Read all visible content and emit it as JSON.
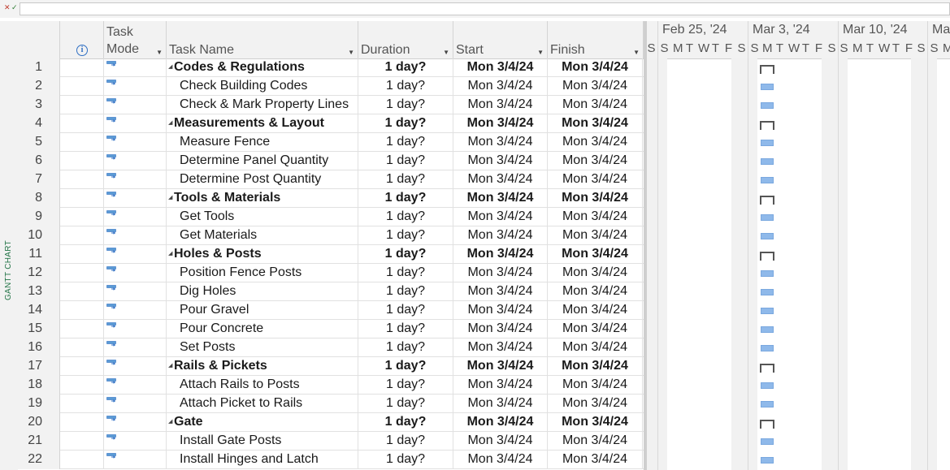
{
  "app": {
    "view_label": "GANTT CHART"
  },
  "entry_bar": {
    "cancel_icon": "cancel-x-icon",
    "accept_icon": "accept-check-icon",
    "value": ""
  },
  "columns": {
    "info_icon": "info-icon",
    "task_mode": "Task\nMode",
    "task_name": "Task Name",
    "duration": "Duration",
    "start": "Start",
    "finish": "Finish"
  },
  "timescale": {
    "weeks": [
      "Feb 25, '24",
      "Mar 3, '24",
      "Mar 10, '24",
      "Ma"
    ],
    "days": [
      "S",
      "S",
      "M",
      "T",
      "W",
      "T",
      "F",
      "S",
      "S",
      "M",
      "T",
      "W",
      "T",
      "F",
      "S",
      "S",
      "M",
      "T",
      "W",
      "T",
      "F",
      "S",
      "S",
      "M"
    ]
  },
  "tasks": [
    {
      "id": "1",
      "name": "Codes & Regulations",
      "duration": "1 day?",
      "start": "Mon 3/4/24",
      "finish": "Mon 3/4/24",
      "summary": true
    },
    {
      "id": "2",
      "name": "Check Building Codes",
      "duration": "1 day?",
      "start": "Mon 3/4/24",
      "finish": "Mon 3/4/24",
      "summary": false
    },
    {
      "id": "3",
      "name": "Check & Mark Property Lines",
      "duration": "1 day?",
      "start": "Mon 3/4/24",
      "finish": "Mon 3/4/24",
      "summary": false
    },
    {
      "id": "4",
      "name": "Measurements & Layout",
      "duration": "1 day?",
      "start": "Mon 3/4/24",
      "finish": "Mon 3/4/24",
      "summary": true
    },
    {
      "id": "5",
      "name": "Measure Fence",
      "duration": "1 day?",
      "start": "Mon 3/4/24",
      "finish": "Mon 3/4/24",
      "summary": false
    },
    {
      "id": "6",
      "name": "Determine Panel Quantity",
      "duration": "1 day?",
      "start": "Mon 3/4/24",
      "finish": "Mon 3/4/24",
      "summary": false
    },
    {
      "id": "7",
      "name": "Determine Post Quantity",
      "duration": "1 day?",
      "start": "Mon 3/4/24",
      "finish": "Mon 3/4/24",
      "summary": false
    },
    {
      "id": "8",
      "name": "Tools & Materials",
      "duration": "1 day?",
      "start": "Mon 3/4/24",
      "finish": "Mon 3/4/24",
      "summary": true
    },
    {
      "id": "9",
      "name": "Get Tools",
      "duration": "1 day?",
      "start": "Mon 3/4/24",
      "finish": "Mon 3/4/24",
      "summary": false
    },
    {
      "id": "10",
      "name": "Get Materials",
      "duration": "1 day?",
      "start": "Mon 3/4/24",
      "finish": "Mon 3/4/24",
      "summary": false
    },
    {
      "id": "11",
      "name": "Holes & Posts",
      "duration": "1 day?",
      "start": "Mon 3/4/24",
      "finish": "Mon 3/4/24",
      "summary": true
    },
    {
      "id": "12",
      "name": "Position Fence Posts",
      "duration": "1 day?",
      "start": "Mon 3/4/24",
      "finish": "Mon 3/4/24",
      "summary": false
    },
    {
      "id": "13",
      "name": "Dig Holes",
      "duration": "1 day?",
      "start": "Mon 3/4/24",
      "finish": "Mon 3/4/24",
      "summary": false
    },
    {
      "id": "14",
      "name": "Pour Gravel",
      "duration": "1 day?",
      "start": "Mon 3/4/24",
      "finish": "Mon 3/4/24",
      "summary": false
    },
    {
      "id": "15",
      "name": "Pour Concrete",
      "duration": "1 day?",
      "start": "Mon 3/4/24",
      "finish": "Mon 3/4/24",
      "summary": false
    },
    {
      "id": "16",
      "name": "Set Posts",
      "duration": "1 day?",
      "start": "Mon 3/4/24",
      "finish": "Mon 3/4/24",
      "summary": false
    },
    {
      "id": "17",
      "name": "Rails & Pickets",
      "duration": "1 day?",
      "start": "Mon 3/4/24",
      "finish": "Mon 3/4/24",
      "summary": true
    },
    {
      "id": "18",
      "name": "Attach Rails to Posts",
      "duration": "1 day?",
      "start": "Mon 3/4/24",
      "finish": "Mon 3/4/24",
      "summary": false
    },
    {
      "id": "19",
      "name": "Attach Picket to Rails",
      "duration": "1 day?",
      "start": "Mon 3/4/24",
      "finish": "Mon 3/4/24",
      "summary": false
    },
    {
      "id": "20",
      "name": "Gate",
      "duration": "1 day?",
      "start": "Mon 3/4/24",
      "finish": "Mon 3/4/24",
      "summary": true
    },
    {
      "id": "21",
      "name": "Install Gate Posts",
      "duration": "1 day?",
      "start": "Mon 3/4/24",
      "finish": "Mon 3/4/24",
      "summary": false
    },
    {
      "id": "22",
      "name": "Install Hinges and Latch",
      "duration": "1 day?",
      "start": "Mon 3/4/24",
      "finish": "Mon 3/4/24",
      "summary": false
    }
  ],
  "colors": {
    "task_bar": "#8fb9ea",
    "summary_bar": "#555555",
    "view_label": "#217346",
    "info_icon": "#2f6fc3"
  }
}
